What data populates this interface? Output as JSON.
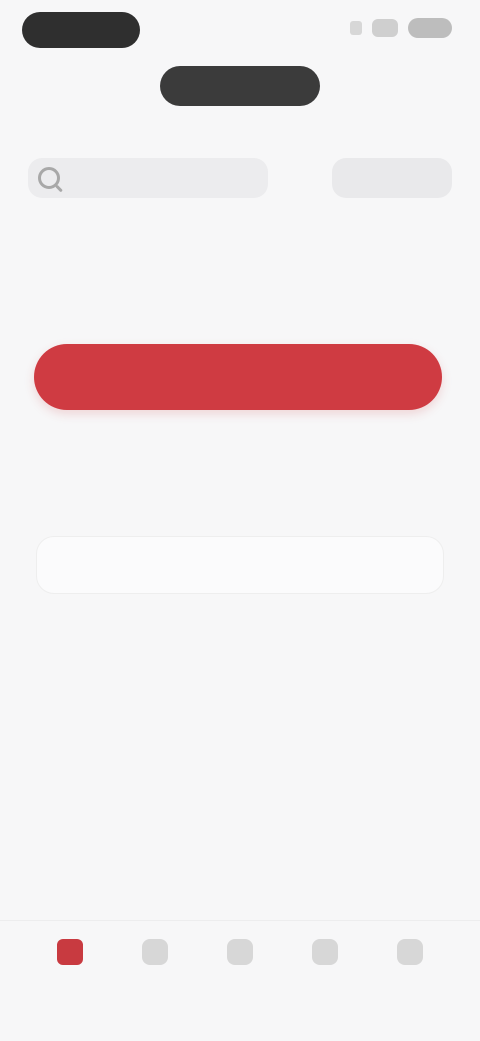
{
  "status_bar": {
    "time": "",
    "icons": [
      "signal-icon",
      "wifi-icon",
      "battery-icon"
    ]
  },
  "header": {
    "title": ""
  },
  "search": {
    "placeholder": ""
  },
  "filter_button": {
    "label": ""
  },
  "content": {
    "section_title": "",
    "paragraph_1": "",
    "primary_button_label": "",
    "paragraph_2": "",
    "subheading": "",
    "secondary_button_label": ""
  },
  "bottom_nav": {
    "items": [
      {
        "label": "",
        "icon": "home-icon",
        "active": true
      },
      {
        "label": "",
        "icon": "list-icon",
        "active": false
      },
      {
        "label": "",
        "icon": "cart-icon",
        "active": false
      },
      {
        "label": "",
        "icon": "chat-icon",
        "active": false
      },
      {
        "label": "",
        "icon": "profile-icon",
        "active": false
      }
    ]
  },
  "colors": {
    "accent": "#cf3b42",
    "background": "#f7f7f8"
  }
}
